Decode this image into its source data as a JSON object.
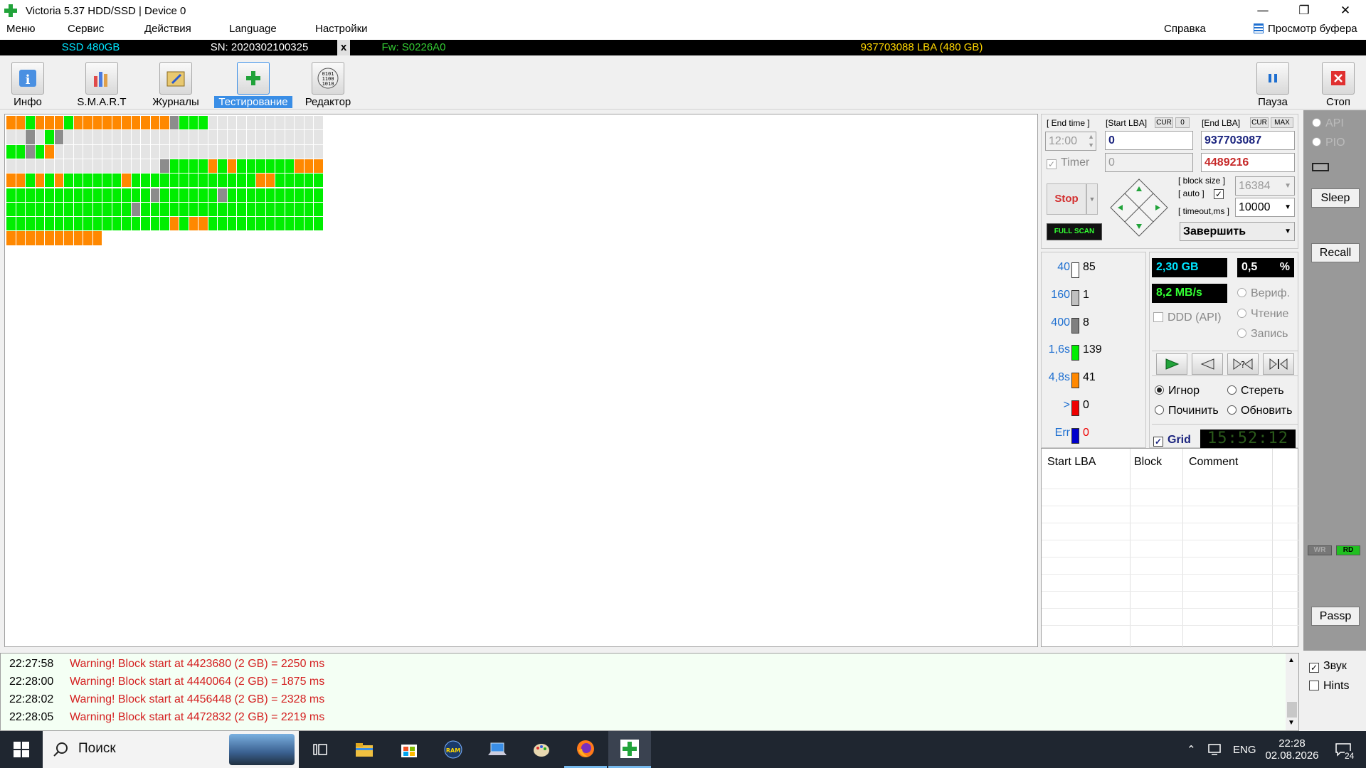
{
  "window": {
    "title": "Victoria 5.37 HDD/SSD | Device 0",
    "minimize": "—",
    "restore": "❐",
    "close": "✕"
  },
  "menu": {
    "items": [
      "Меню",
      "Сервис",
      "Действия",
      "Language",
      "Настройки"
    ],
    "help": "Справка",
    "clipboard": "Просмотр буфера"
  },
  "device": {
    "model": "SSD 480GB",
    "serial": "SN: 2020302100325",
    "sep": "x",
    "firmware": "Fw: S0226A0",
    "lba": "937703088 LBA (480 GB)",
    "colors": {
      "model": "#00e5ff",
      "serial": "#ffffff",
      "firmware": "#33cc33",
      "lba": "#ffd700"
    }
  },
  "toolbar": {
    "items": [
      {
        "label": "Инфо",
        "icon": "info-icon"
      },
      {
        "label": "S.M.A.R.T",
        "icon": "smart-icon"
      },
      {
        "label": "Журналы",
        "icon": "logs-icon"
      },
      {
        "label": "Тестирование",
        "icon": "test-icon",
        "active": true
      },
      {
        "label": "Редактор",
        "icon": "editor-icon"
      }
    ],
    "pause": "Пауза",
    "stop": "Стоп"
  },
  "grid": {
    "cols": 33,
    "rows": [
      "OOGOOOGOOOOOOOOOODGGG",
      "LLDLGDLLLLLLLLLLLLLLLLLLLLLLLLLLL",
      "GGDGOLLLLLLLLLLLLLLLLLLLLLLLLLLLL",
      "LLLLLLLLLLLLLLLLDGGGGOGOGGGGGGOOO",
      "OOGOGOGGGGGGOGGGGGGGGGGGGGOOGGGGG",
      "GGGGGGGGGGGGGGGDGGGGGGDGGGGGGGGGG",
      "GGGGGGGGGGGGGDGGGGGGGGGGGGGGGGGGG",
      "GGGGGGGGGGGGGGGGGOGOOGGGGGGGGGGGG",
      "OOOOOOOOOO"
    ],
    "colors": {
      "G": "#00ee00",
      "O": "#ff8800",
      "D": "#8c8c8c",
      "L": "#e4e4e4"
    }
  },
  "controls": {
    "end_time_label": "[ End time ]",
    "end_time": "12:00",
    "timer_label": "Timer",
    "start_lba_label": "[Start LBA]",
    "cur": "CUR",
    "zero": "0",
    "start_lba": "0",
    "start_lba_cur": "0",
    "end_lba_label": "[End LBA]",
    "max": "MAX",
    "end_lba": "937703087",
    "end_lba_cur": "4489216",
    "stop_button": "Stop",
    "full_scan": "FULL SCAN",
    "block_size_label": "[ block size ]",
    "auto_label": "[ auto ]",
    "block_size": "16384",
    "timeout_label": "[ timeout,ms ]",
    "timeout": "10000",
    "finish_action": "Завершить",
    "done_gb": "2,30 GB",
    "percent": "0,5",
    "percent_sign": "%",
    "speed": "8,2 MB/s",
    "ddd": "DDD (API)",
    "verify": "Вериф.",
    "read": "Чтение",
    "write": "Запись",
    "ignore": "Игнор",
    "erase": "Стереть",
    "repair": "Починить",
    "refresh": "Обновить",
    "grid_label": "Grid",
    "clock": "15:52:12"
  },
  "histogram": [
    {
      "label": "40",
      "value": "85",
      "color": "#ffffff",
      "lcolor": "#1e6fd0"
    },
    {
      "label": "160",
      "value": "1",
      "color": "#c0c0c0",
      "lcolor": "#1e6fd0"
    },
    {
      "label": "400",
      "value": "8",
      "color": "#808080",
      "lcolor": "#1e6fd0"
    },
    {
      "label": "1,6s",
      "value": "139",
      "color": "#00ee00",
      "lcolor": "#1e6fd0"
    },
    {
      "label": "4,8s",
      "value": "41",
      "color": "#ff8800",
      "lcolor": "#1e6fd0"
    },
    {
      "label": ">",
      "value": "0",
      "color": "#ee0000",
      "lcolor": "#1e6fd0"
    },
    {
      "label": "Err",
      "value": "0",
      "color": "#0000cc",
      "lcolor": "#1e6fd0",
      "vcolor": "#ee0000"
    }
  ],
  "table": {
    "headers": [
      "Start LBA",
      "Block",
      "Comment"
    ]
  },
  "right": {
    "api": "API",
    "pio": "PIO",
    "sleep": "Sleep",
    "recall": "Recall",
    "wr": "WR",
    "rd": "RD",
    "passp": "Passp",
    "sound": "Звук",
    "hints": "Hints"
  },
  "log": [
    {
      "time": "22:27:58",
      "msg": "Warning! Block start at 4423680 (2 GB)  = 2250 ms"
    },
    {
      "time": "22:28:00",
      "msg": "Warning! Block start at 4440064 (2 GB)  = 1875 ms"
    },
    {
      "time": "22:28:02",
      "msg": "Warning! Block start at 4456448 (2 GB)  = 2328 ms"
    },
    {
      "time": "22:28:05",
      "msg": "Warning! Block start at 4472832 (2 GB)  = 2219 ms"
    }
  ],
  "taskbar": {
    "search": "Поиск",
    "lang": "ENG",
    "time": "22:28",
    "date": "02.08.2026",
    "notif": "24"
  }
}
